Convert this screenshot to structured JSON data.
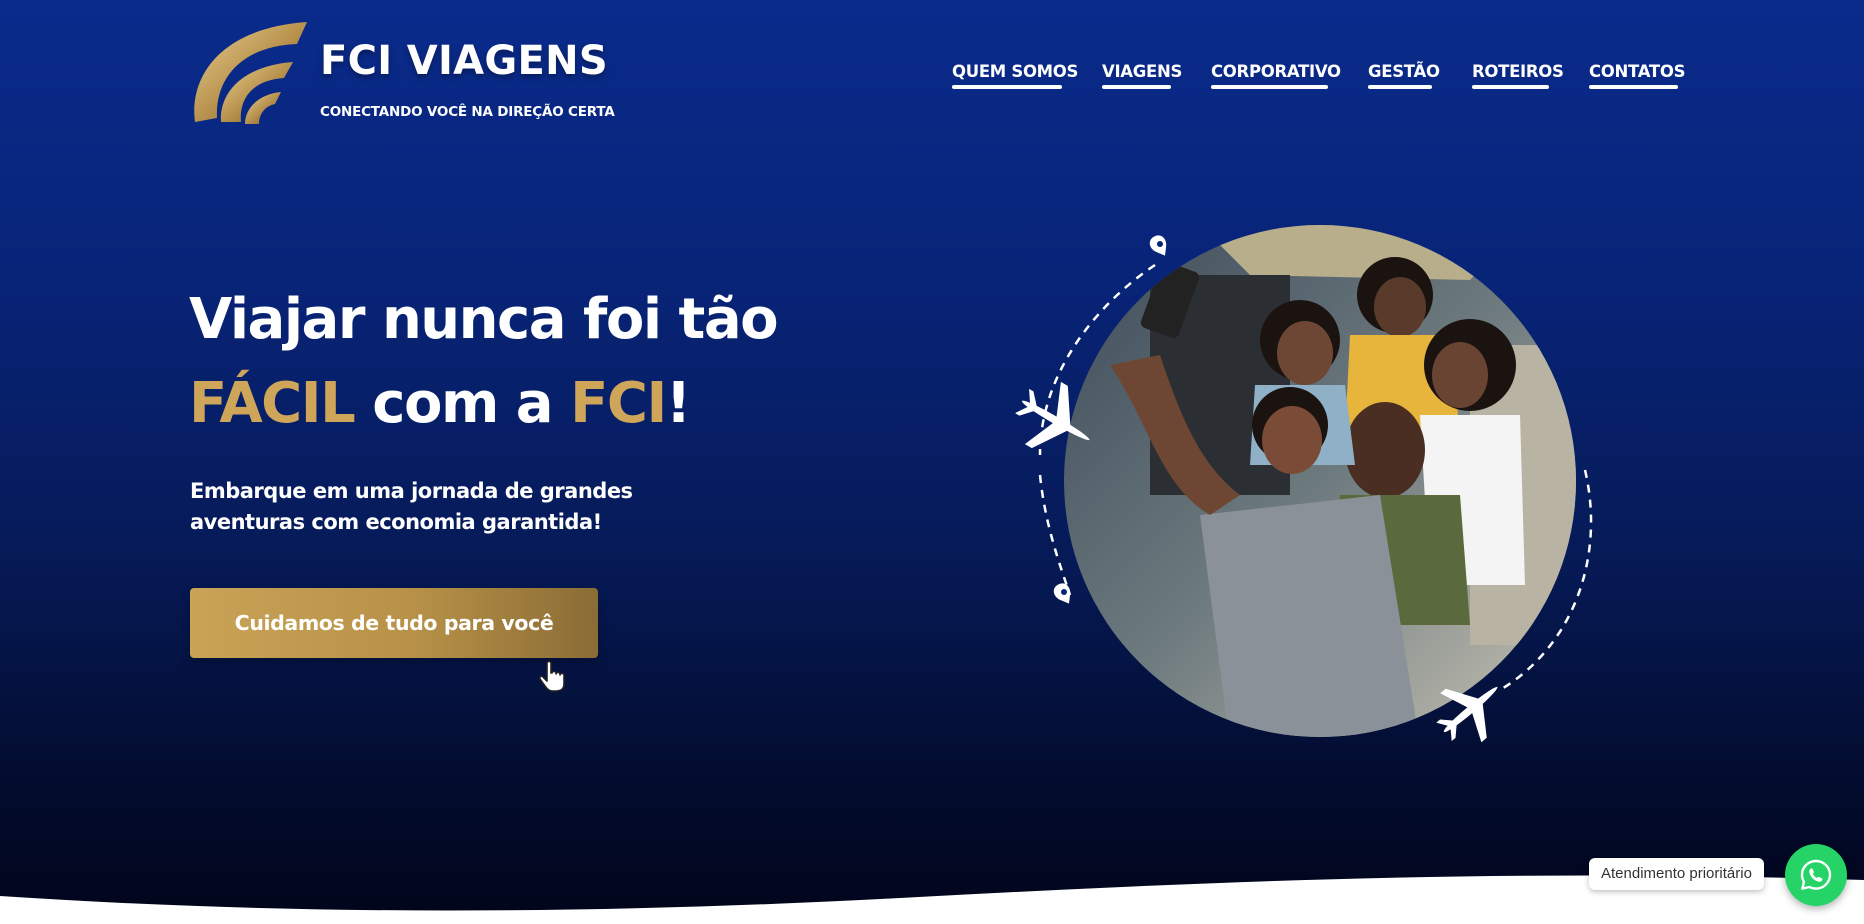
{
  "brand": {
    "name": "FCI VIAGENS",
    "tagline": "CONECTANDO VOCÊ NA DIREÇÃO CERTA"
  },
  "nav": {
    "items": [
      {
        "label": "QUEM SOMOS"
      },
      {
        "label": "VIAGENS"
      },
      {
        "label": "CORPORATIVO"
      },
      {
        "label": "GESTÃO"
      },
      {
        "label": "ROTEIROS"
      },
      {
        "label": "CONTATOS"
      }
    ]
  },
  "hero": {
    "headline": {
      "line1": "Viajar nunca foi tão",
      "word_easy": "FÁCIL",
      "connector": " com a ",
      "word_brand": "FCI",
      "exclaim": "!"
    },
    "subheadline": "Embarque em uma jornada de grandes aventuras com economia garantida!",
    "cta_label": "Cuidamos de tudo para você",
    "image_alt": "Família sorrindo tirando selfie"
  },
  "chat": {
    "label": "Atendimento prioritário",
    "icon": "whatsapp-icon"
  },
  "colors": {
    "gold": "#cfa55a",
    "navy": "#0a2b8c",
    "whatsapp": "#25d366"
  }
}
